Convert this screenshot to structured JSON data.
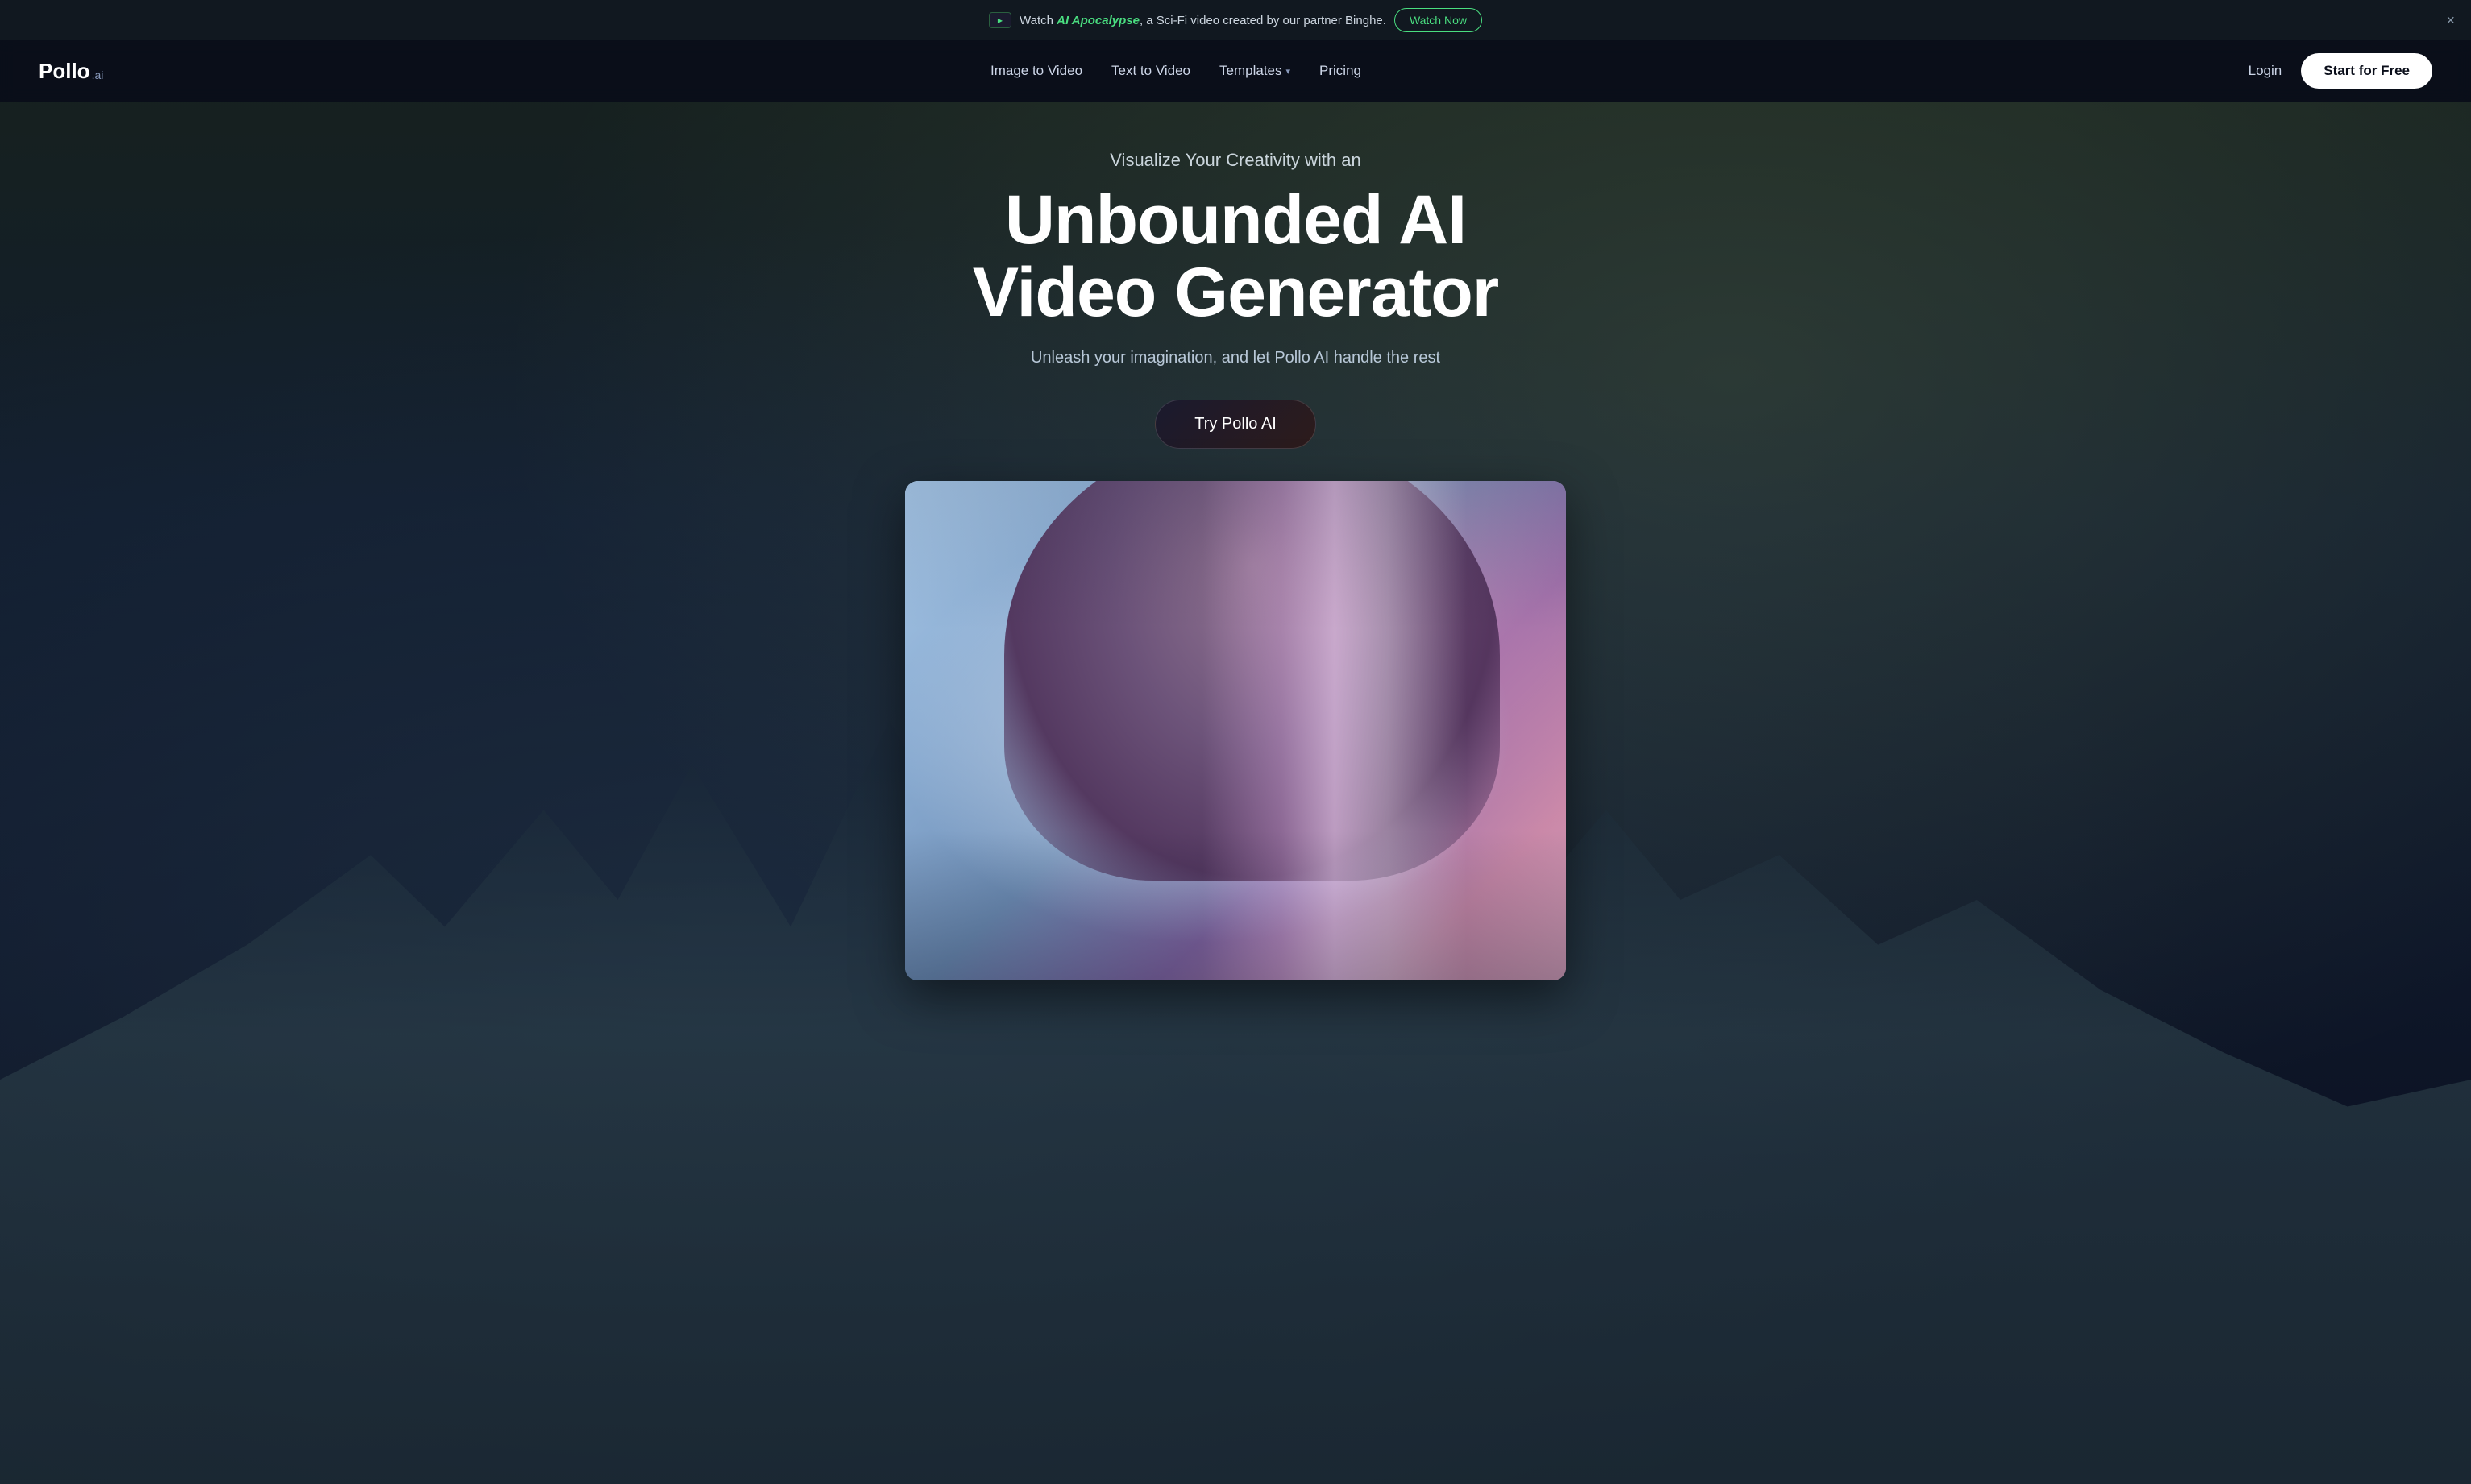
{
  "announcement": {
    "pre_text": "Watch ",
    "highlight_text": "AI Apocalypse",
    "post_text": ", a Sci-Fi video created by our partner Binghe.",
    "watch_btn_label": "Watch Now",
    "close_label": "×"
  },
  "navbar": {
    "logo_text": "Pollo",
    "logo_suffix": ".ai",
    "links": [
      {
        "label": "Image to Video",
        "id": "image-to-video"
      },
      {
        "label": "Text to Video",
        "id": "text-to-video"
      },
      {
        "label": "Templates",
        "id": "templates",
        "has_dropdown": true
      },
      {
        "label": "Pricing",
        "id": "pricing"
      }
    ],
    "login_label": "Login",
    "start_free_label": "Start for Free"
  },
  "hero": {
    "subtitle": "Visualize Your Creativity with an",
    "title_line1": "Unbounded AI",
    "title_line2": "Video Generator",
    "description": "Unleash your imagination, and let Pollo AI handle the rest",
    "cta_label": "Try Pollo AI"
  }
}
